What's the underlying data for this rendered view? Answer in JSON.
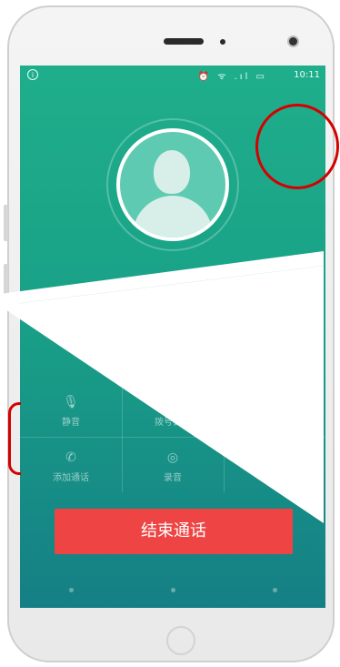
{
  "statusbar": {
    "left_icon": "i",
    "icons": "⏰ ᯤ .ıl ▭",
    "time": "10:11"
  },
  "call": {
    "caller_name": "",
    "end_call_label": "结束通话"
  },
  "controls": [
    {
      "icon": "mic-icon",
      "glyph": "🎙",
      "label": "静音"
    },
    {
      "icon": "dialpad-icon",
      "glyph": "⋮",
      "label": "拨号键盘"
    },
    {
      "icon": "speaker-icon",
      "glyph": "",
      "label": ""
    },
    {
      "icon": "add-call-icon",
      "glyph": "✆",
      "label": "添加通话"
    },
    {
      "icon": "record-icon",
      "glyph": "◎",
      "label": "录音"
    },
    {
      "icon": "contacts-icon",
      "glyph": "",
      "label": ""
    }
  ],
  "colors": {
    "screen_top": "#1fae8b",
    "screen_bottom": "#157f85",
    "end_call": "#ee4444",
    "annotation": "#d40000"
  }
}
